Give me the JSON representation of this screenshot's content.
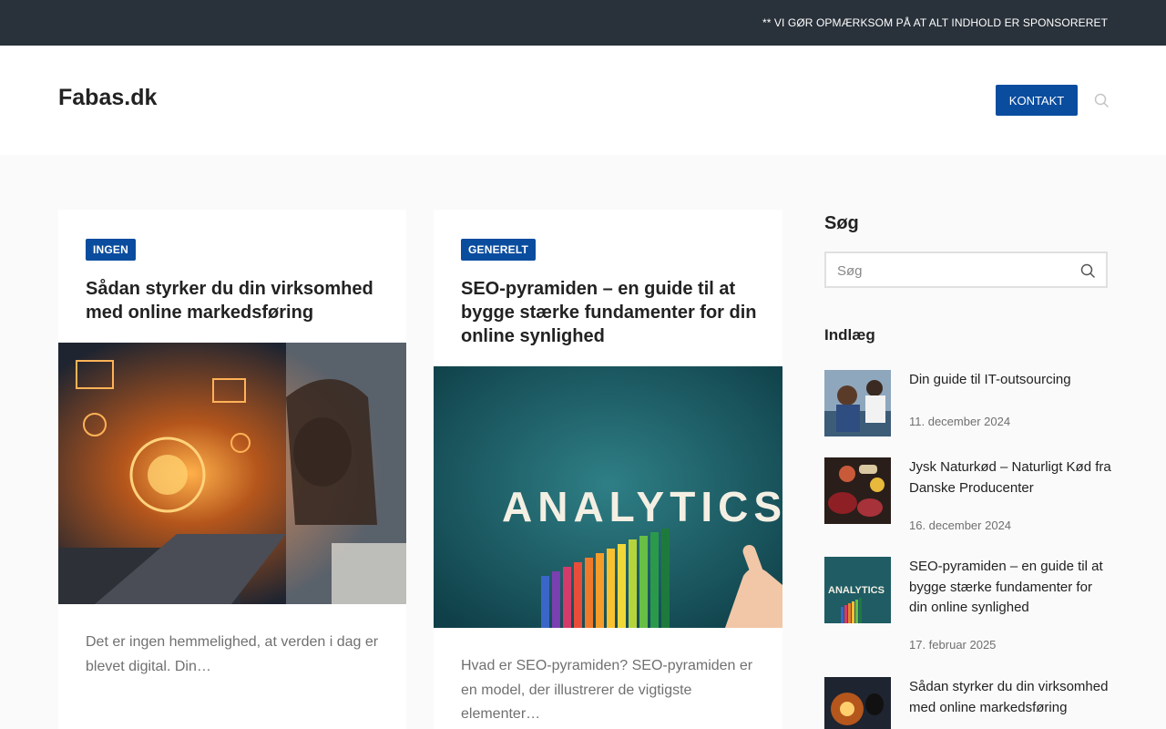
{
  "topbar": {
    "notice": "** VI GØR OPMÆRKSOM PÅ AT ALT INDHOLD ER SPONSORERET"
  },
  "header": {
    "logo": "Fabas.dk",
    "contact_label": "KONTAKT"
  },
  "articles": [
    {
      "category": "INGEN",
      "title": "Sådan styrker du din virksomhed med online markedsføring",
      "excerpt": "Det er ingen hemmelighed, at verden i dag er blevet digital. Din…"
    },
    {
      "category": "GENERELT",
      "title": "SEO-pyramiden – en guide til at bygge stærke fundamenter for din online synlighed",
      "excerpt": "Hvad er SEO-pyramiden? SEO-pyramiden er en model, der illustrerer de vigtigste elementer…",
      "image_text": "ANALYTICS"
    }
  ],
  "sidebar": {
    "search_title": "Søg",
    "search_placeholder": "Søg",
    "posts_title": "Indlæg",
    "posts": [
      {
        "title": "Din guide til IT-outsourcing",
        "date": "11. december 2024"
      },
      {
        "title": "Jysk Naturkød – Naturligt Kød fra Danske Producenter",
        "date": "16. december 2024"
      },
      {
        "title": "SEO-pyramiden – en guide til at bygge stærke fundamenter for din online synlighed",
        "date": "17. februar 2025",
        "thumb_text": "ANALYTICS"
      },
      {
        "title": "Sådan styrker du din virksomhed med online markedsføring"
      }
    ]
  },
  "colors": {
    "accent": "#0a4d9f",
    "topbar": "#29313a",
    "background": "#fafafa",
    "muted_text": "#707070"
  },
  "icons": {
    "header_search": "search-icon",
    "sidebar_search": "search-icon"
  }
}
